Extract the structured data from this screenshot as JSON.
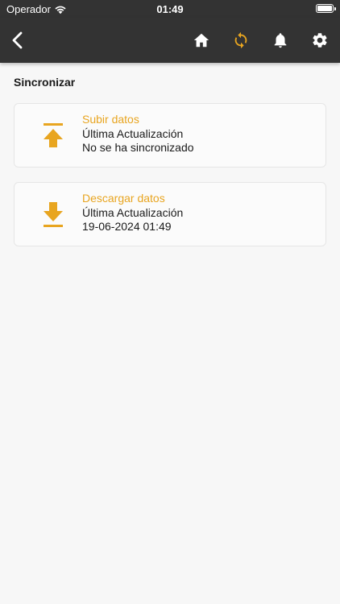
{
  "status_bar": {
    "carrier": "Operador",
    "time": "01:49"
  },
  "nav": {
    "icons": [
      "back-icon",
      "home-icon",
      "sync-icon",
      "bell-icon",
      "gear-icon"
    ],
    "active_color": "#e8a520",
    "icon_color": "#ffffff"
  },
  "section_title": "Sincronizar",
  "cards": [
    {
      "title": "Subir datos",
      "subtitle": "Última Actualización",
      "status": "No se ha sincronizado",
      "icon": "upload-icon"
    },
    {
      "title": "Descargar datos",
      "subtitle": "Última Actualización",
      "status": "19-06-2024 01:49",
      "icon": "download-icon"
    }
  ],
  "colors": {
    "accent": "#e8a520",
    "bar_background": "#333333",
    "page_background": "#f7f7f7"
  }
}
